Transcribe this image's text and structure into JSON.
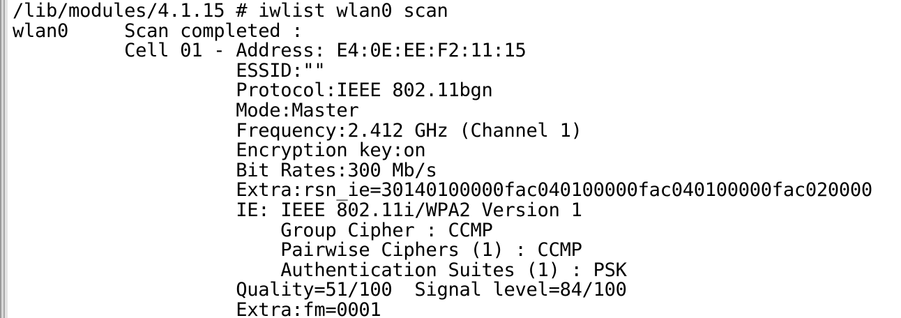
{
  "terminal": {
    "lines": [
      "/lib/modules/4.1.15 # iwlist wlan0 scan",
      "wlan0     Scan completed :",
      "          Cell 01 - Address: E4:0E:EE:F2:11:15",
      "                    ESSID:\"\"",
      "                    Protocol:IEEE 802.11bgn",
      "                    Mode:Master",
      "                    Frequency:2.412 GHz (Channel 1)",
      "                    Encryption key:on",
      "                    Bit Rates:300 Mb/s",
      "                    Extra:rsn_ie=30140100000fac040100000fac040100000fac020000",
      "                    IE: IEEE 802.11i/WPA2 Version 1",
      "                        Group Cipher : CCMP",
      "                        Pairwise Ciphers (1) : CCMP",
      "                        Authentication Suites (1) : PSK",
      "                    Quality=51/100  Signal level=84/100",
      "                    Extra:fm=0001"
    ]
  }
}
